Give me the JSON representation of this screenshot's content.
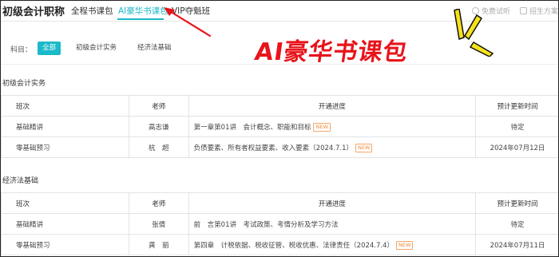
{
  "header": {
    "brand": "初级会计职称",
    "tabs": [
      {
        "label": "全程书课包",
        "active": false
      },
      {
        "label": "AI豪华书课包",
        "active": true
      },
      {
        "label": "VIP夺魁班",
        "active": false
      }
    ],
    "links": [
      {
        "label": "免费试听",
        "icon": "clock-icon"
      },
      {
        "label": "招生方案",
        "icon": "document-icon"
      }
    ]
  },
  "filter": {
    "label": "科目：",
    "options": [
      {
        "label": "全部",
        "active": true
      },
      {
        "label": "初级会计实务",
        "active": false
      },
      {
        "label": "经济法基础",
        "active": false
      }
    ]
  },
  "promo": {
    "title": "AI豪华书课包",
    "color": "#e8141b"
  },
  "accent_color": "#1bb9c9",
  "sections": [
    {
      "title": "初级会计实务",
      "headers": [
        "班次",
        "老师",
        "开通进度",
        "预计更新时间"
      ],
      "rows": [
        {
          "class": "基础精讲",
          "teacher": "高志谦",
          "progress": "第一章第01讲　会计概念、职能和目标",
          "new": "NEW",
          "date": "待定"
        },
        {
          "class": "零基础预习",
          "teacher": "杭　超",
          "progress": "负债要素、所有者权益要素、收入要素（2024.7.1）",
          "new": "NEW",
          "date": "2024年07月12日"
        }
      ]
    },
    {
      "title": "经济法基础",
      "headers": [
        "班次",
        "老师",
        "开通进度",
        "预计更新时间"
      ],
      "rows": [
        {
          "class": "基础精讲",
          "teacher": "张倩",
          "progress": "前　言第01讲　考试政策、考情分析及学习方法",
          "new": "",
          "date": "待定"
        },
        {
          "class": "零基础预习",
          "teacher": "龚　丽",
          "progress": "第四章　计税依据、税收征管、税收优惠、法律责任（2024.7.4）",
          "new": "NEW",
          "date": "2024年07月11日"
        }
      ]
    }
  ]
}
